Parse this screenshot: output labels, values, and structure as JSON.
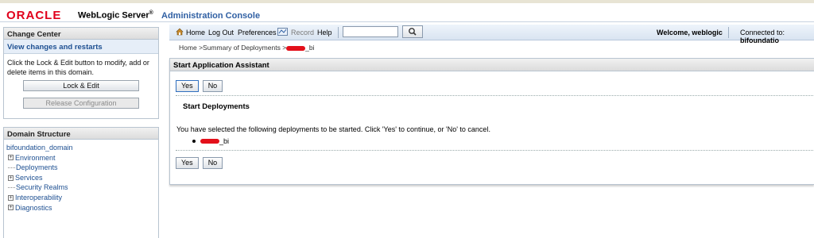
{
  "brand": {
    "oracle": "ORACLE",
    "product": "WebLogic Server",
    "reg": "®",
    "console": "Administration Console"
  },
  "change_center": {
    "title": "Change Center",
    "subtitle": "View changes and restarts",
    "instructions": "Click the Lock & Edit button to modify, add or delete items in this domain.",
    "lock_edit_label": "Lock & Edit",
    "release_label": "Release Configuration"
  },
  "domain_structure": {
    "title": "Domain Structure",
    "root": "bifoundation_domain",
    "items": [
      {
        "label": "Environment",
        "expandable": true
      },
      {
        "label": "Deployments",
        "expandable": false
      },
      {
        "label": "Services",
        "expandable": true
      },
      {
        "label": "Security Realms",
        "expandable": false
      },
      {
        "label": "Interoperability",
        "expandable": true
      },
      {
        "label": "Diagnostics",
        "expandable": true
      }
    ]
  },
  "toolbar": {
    "home": "Home",
    "logout": "Log Out",
    "preferences": "Preferences",
    "record": "Record",
    "help": "Help",
    "search_value": "",
    "welcome": "Welcome, weblogic",
    "connected_label": "Connected to:",
    "connected_value": "bifoundatio"
  },
  "breadcrumb": {
    "home": "Home",
    "sep": ">",
    "summary": "Summary of Deployments",
    "suffix": "_bi"
  },
  "assistant": {
    "title": "Start Application Assistant",
    "yes": "Yes",
    "no": "No",
    "section_title": "Start Deployments",
    "message": "You have selected the following deployments to be started. Click 'Yes' to continue, or 'No' to cancel.",
    "deployment_suffix": "_bi"
  },
  "colors": {
    "oracle_red": "#e0001b",
    "link_blue": "#1d4f91",
    "header_blue": "#d9e4f1"
  }
}
